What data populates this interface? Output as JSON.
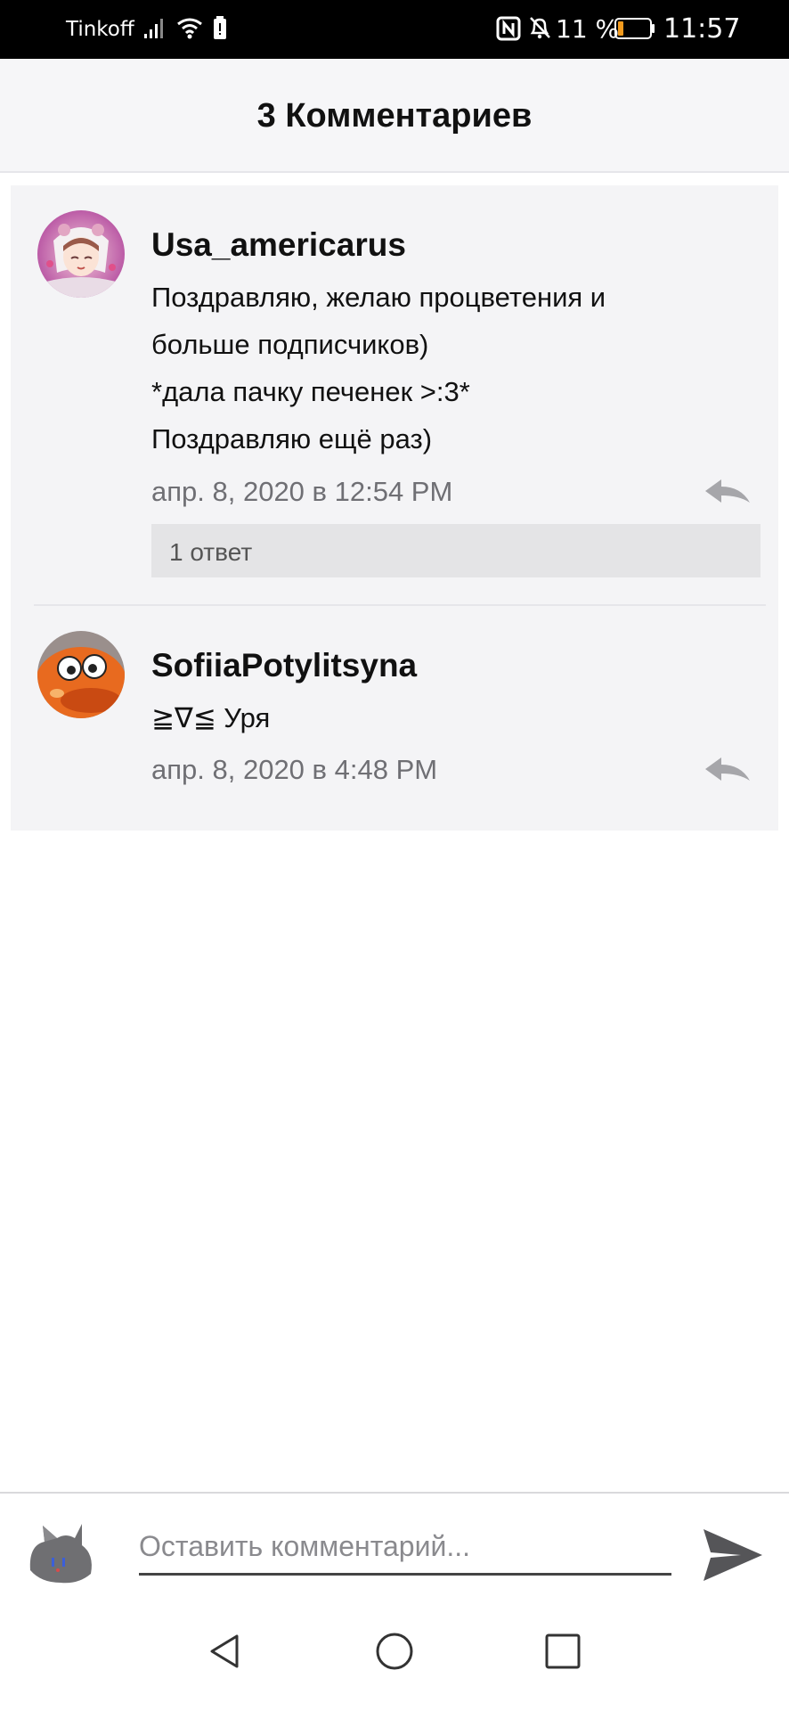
{
  "status_bar": {
    "carrier": "Tinkoff",
    "battery_percent": "11 %",
    "time": "11:57",
    "icons": [
      "signal-icon",
      "wifi-icon",
      "battery-saver-icon",
      "nfc-icon",
      "bell-off-icon",
      "battery-icon"
    ],
    "battery_level": 0.11,
    "battery_color": "#f29b1e"
  },
  "header": {
    "title": "3 Комментариев"
  },
  "comments": [
    {
      "author": "Usa_americarus",
      "avatar": "anime-girl-avatar",
      "lines": [
        "Поздравляю, желаю процветения и",
        "больше подписчиков)",
        "*дала пачку печенек >:3*",
        "Поздравляю ещё раз)"
      ],
      "timestamp": "апр. 8, 2020 в 12:54 PM",
      "replies_label": "1 ответ"
    },
    {
      "author": "SofiiaPotylitsyna",
      "avatar": "orange-cartoon-avatar",
      "lines": [
        "≧∇≦ Уря"
      ],
      "timestamp": "апр. 8, 2020 в 4:48 PM"
    }
  ],
  "composer": {
    "placeholder": "Оставить комментарий...",
    "avatar": "grey-cat-avatar",
    "send_icon": "send-icon"
  },
  "navigation": {
    "icons": [
      "back-icon",
      "home-icon",
      "recents-icon"
    ]
  },
  "colors": {
    "header_bg": "#f6f6f8",
    "comment_bg": "#f4f4f6",
    "muted_text": "#6f6f74",
    "replies_bg": "#e4e4e6"
  }
}
